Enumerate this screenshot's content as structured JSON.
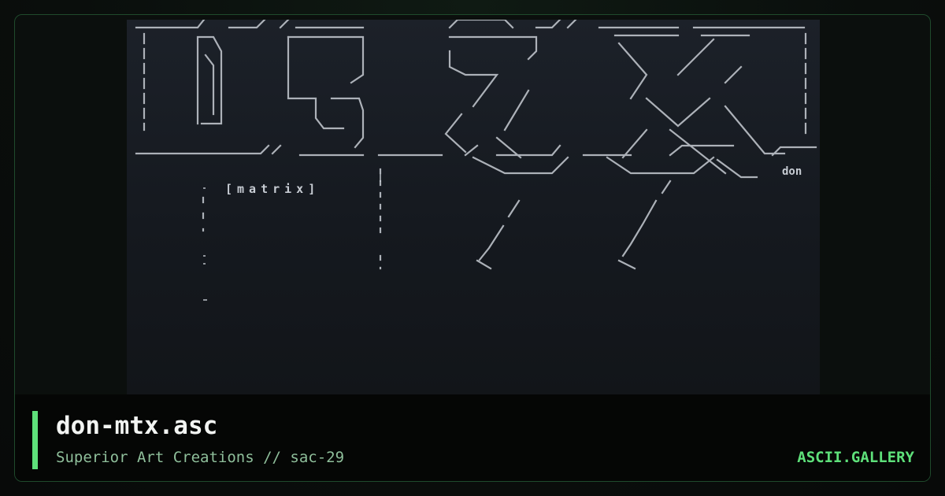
{
  "artwork": {
    "tag_text": "[matrix]",
    "signature": "don"
  },
  "card": {
    "title": "don-mtx.asc",
    "subtitle": "Superior Art Creations // sac-29",
    "brand": "ASCII.GALLERY"
  },
  "colors": {
    "accent": "#5ee07a",
    "frame_border": "#1f4a2c",
    "art_background": "#1a1f26",
    "ascii_glyph": "#c7ccd3",
    "title": "#f2f4f2",
    "subtitle": "#8fbf9b"
  }
}
